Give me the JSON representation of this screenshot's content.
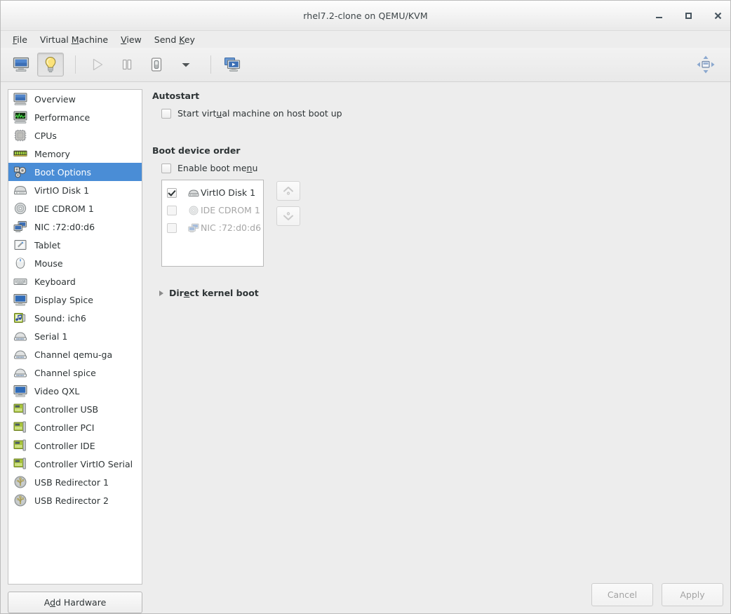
{
  "window": {
    "title": "rhel7.2-clone on QEMU/KVM",
    "controls": {
      "minimize": "minimize",
      "maximize": "maximize",
      "close": "✕"
    }
  },
  "menubar": {
    "items": [
      {
        "label": "File",
        "mnemonic": "F"
      },
      {
        "label": "Virtual Machine",
        "mnemonic": "M"
      },
      {
        "label": "View",
        "mnemonic": "V"
      },
      {
        "label": "Send Key",
        "mnemonic": "K"
      }
    ]
  },
  "toolbar": {
    "buttons": [
      {
        "name": "console-view-button",
        "icon": "monitor-icon",
        "state": "normal"
      },
      {
        "name": "details-view-button",
        "icon": "lightbulb-icon",
        "state": "pressed"
      },
      {
        "name": "run-button",
        "icon": "play-icon",
        "state": "disabled"
      },
      {
        "name": "pause-button",
        "icon": "pause-icon",
        "state": "normal"
      },
      {
        "name": "shutdown-button",
        "icon": "power-icon",
        "state": "normal"
      },
      {
        "name": "shutdown-menu-button",
        "icon": "chevron-down-icon",
        "state": "normal"
      },
      {
        "name": "snapshots-button",
        "icon": "snapshot-icon",
        "state": "normal"
      }
    ],
    "fullscreen": {
      "name": "fullscreen-button",
      "icon": "expand-icon"
    }
  },
  "sidebar": {
    "items": [
      {
        "label": "Overview",
        "icon": "monitor-icon",
        "selected": false
      },
      {
        "label": "Performance",
        "icon": "graph-monitor-icon",
        "selected": false
      },
      {
        "label": "CPUs",
        "icon": "cpu-chip-icon",
        "selected": false
      },
      {
        "label": "Memory",
        "icon": "memory-stick-icon",
        "selected": false
      },
      {
        "label": "Boot Options",
        "icon": "boot-gears-icon",
        "selected": true
      },
      {
        "label": "VirtIO Disk 1",
        "icon": "hard-disk-icon",
        "selected": false
      },
      {
        "label": "IDE CDROM 1",
        "icon": "cdrom-icon",
        "selected": false
      },
      {
        "label": "NIC :72:d0:d6",
        "icon": "network-icon",
        "selected": false
      },
      {
        "label": "Tablet",
        "icon": "tablet-pen-icon",
        "selected": false
      },
      {
        "label": "Mouse",
        "icon": "mouse-icon",
        "selected": false
      },
      {
        "label": "Keyboard",
        "icon": "keyboard-icon",
        "selected": false
      },
      {
        "label": "Display Spice",
        "icon": "display-icon",
        "selected": false
      },
      {
        "label": "Sound: ich6",
        "icon": "sound-icon",
        "selected": false
      },
      {
        "label": "Serial 1",
        "icon": "serial-port-icon",
        "selected": false
      },
      {
        "label": "Channel qemu-ga",
        "icon": "serial-port-icon",
        "selected": false
      },
      {
        "label": "Channel spice",
        "icon": "serial-port-icon",
        "selected": false
      },
      {
        "label": "Video QXL",
        "icon": "display-icon",
        "selected": false
      },
      {
        "label": "Controller USB",
        "icon": "controller-card-icon",
        "selected": false
      },
      {
        "label": "Controller PCI",
        "icon": "controller-card-icon",
        "selected": false
      },
      {
        "label": "Controller IDE",
        "icon": "controller-card-icon",
        "selected": false
      },
      {
        "label": "Controller VirtIO Serial",
        "icon": "controller-card-icon",
        "selected": false
      },
      {
        "label": "USB Redirector 1",
        "icon": "usb-icon",
        "selected": false
      },
      {
        "label": "USB Redirector 2",
        "icon": "usb-icon",
        "selected": false
      }
    ],
    "add_hardware_label": "Add Hardware",
    "add_hardware_mnemonic": "d"
  },
  "main": {
    "autostart": {
      "title": "Autostart",
      "checkbox": {
        "label_before": "Start virt",
        "label_mnemonic": "u",
        "label_after": "al machine on host boot up",
        "checked": false
      }
    },
    "boot_device_order": {
      "title": "Boot device order",
      "enable_boot_menu": {
        "label_before": "Enable boot me",
        "label_mnemonic": "n",
        "label_after": "u",
        "checked": false
      },
      "devices": [
        {
          "label": "VirtIO Disk 1",
          "icon": "hard-disk-icon",
          "checked": true,
          "enabled": true
        },
        {
          "label": "IDE CDROM 1",
          "icon": "cdrom-icon",
          "checked": false,
          "enabled": false
        },
        {
          "label": "NIC :72:d0:d6",
          "icon": "network-icon",
          "checked": false,
          "enabled": false
        }
      ],
      "move_up": {
        "name": "move-up-button",
        "icon": "chevron-up-icon",
        "enabled": false
      },
      "move_down": {
        "name": "move-down-button",
        "icon": "chevron-down-icon",
        "enabled": false
      }
    },
    "direct_kernel_boot": {
      "label_before": "Dir",
      "label_mnemonic": "e",
      "label_after": "ct kernel boot",
      "expanded": false
    }
  },
  "footer": {
    "cancel_label": "Cancel",
    "apply_label": "Apply",
    "cancel_enabled": false,
    "apply_enabled": false
  },
  "colors": {
    "selection_blue": "#4a8dd6",
    "window_bg": "#ededed",
    "list_bg": "#ffffff",
    "text": "#2e3436",
    "disabled_text": "#a6a6a6"
  }
}
